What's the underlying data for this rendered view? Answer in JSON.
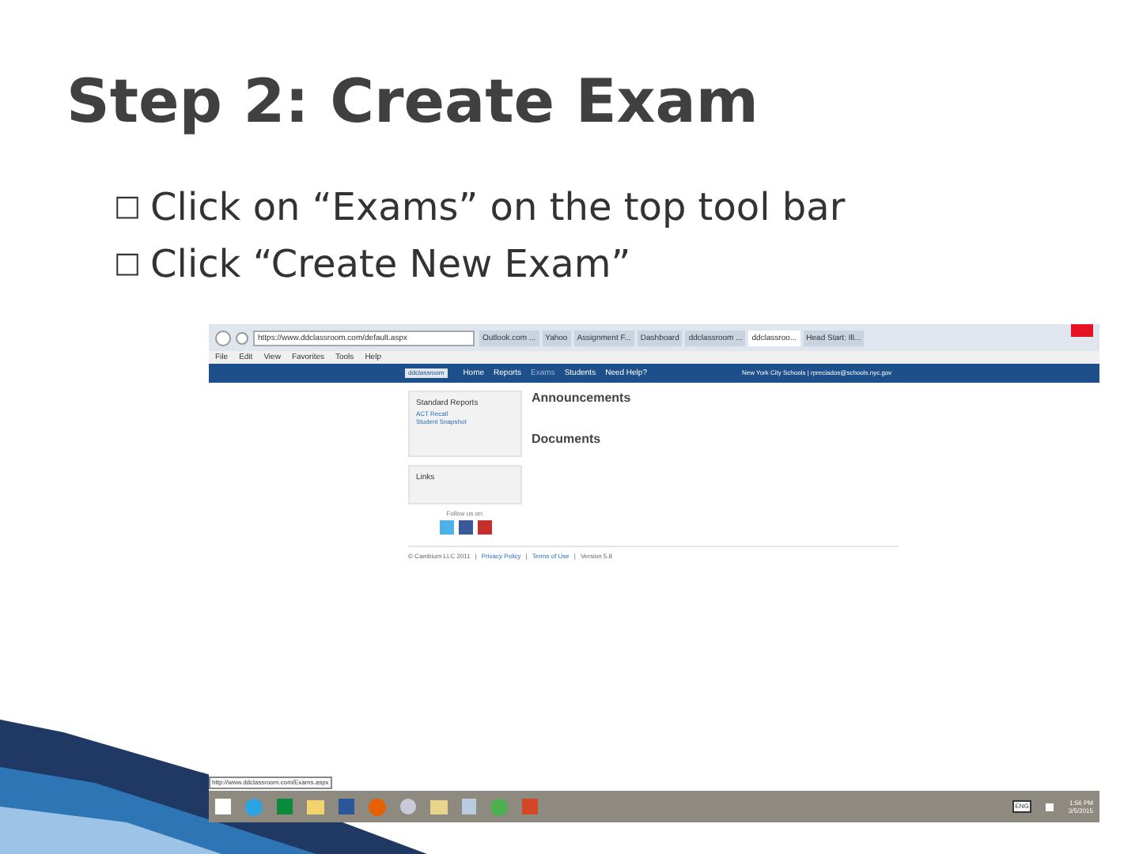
{
  "slide": {
    "title": "Step 2: Create Exam",
    "bullets": [
      {
        "marker": "□",
        "text": "Click on “Exams” on the top tool bar"
      },
      {
        "marker": "□",
        "text": "Click “Create New Exam”"
      }
    ]
  },
  "browser": {
    "address": "https://www.ddclassroom.com/default.aspx",
    "tabs": [
      {
        "label": "Outlook.com ...",
        "selected": false
      },
      {
        "label": "Yahoo",
        "selected": false
      },
      {
        "label": "Assignment F...",
        "selected": false
      },
      {
        "label": "Dashboard",
        "selected": false
      },
      {
        "label": "ddclassroom ...",
        "selected": false
      },
      {
        "label": "ddclassroo...",
        "selected": true
      },
      {
        "label": "Head Start: Ill...",
        "selected": false
      }
    ],
    "menu": [
      "File",
      "Edit",
      "View",
      "Favorites",
      "Tools",
      "Help"
    ],
    "site": {
      "logo": "ddclassroom",
      "nav": [
        {
          "label": "Home",
          "selected": false
        },
        {
          "label": "Reports",
          "selected": false
        },
        {
          "label": "Exams",
          "selected": true
        },
        {
          "label": "Students",
          "selected": false
        },
        {
          "label": "Need Help?",
          "selected": false
        }
      ],
      "account": "New York City Schools | rpreciados@schools.nyc.gov",
      "reports": {
        "title": "Standard Reports",
        "links": [
          "ACT Recall",
          "Student Snapshot"
        ]
      },
      "links_title": "Links",
      "follow": "Follow us on:",
      "announcements": "Announcements",
      "documents": "Documents",
      "footer": [
        "© Cambium LLC 2011",
        "Privacy Policy",
        "Terms of Use",
        "Version 5.8"
      ],
      "footer_separator": "|"
    },
    "status_url": "http://www.ddclassroom.com/Exams.aspx"
  },
  "taskbar": {
    "keyboard": "ENG",
    "time": "1:56 PM",
    "date": "3/5/2015"
  }
}
